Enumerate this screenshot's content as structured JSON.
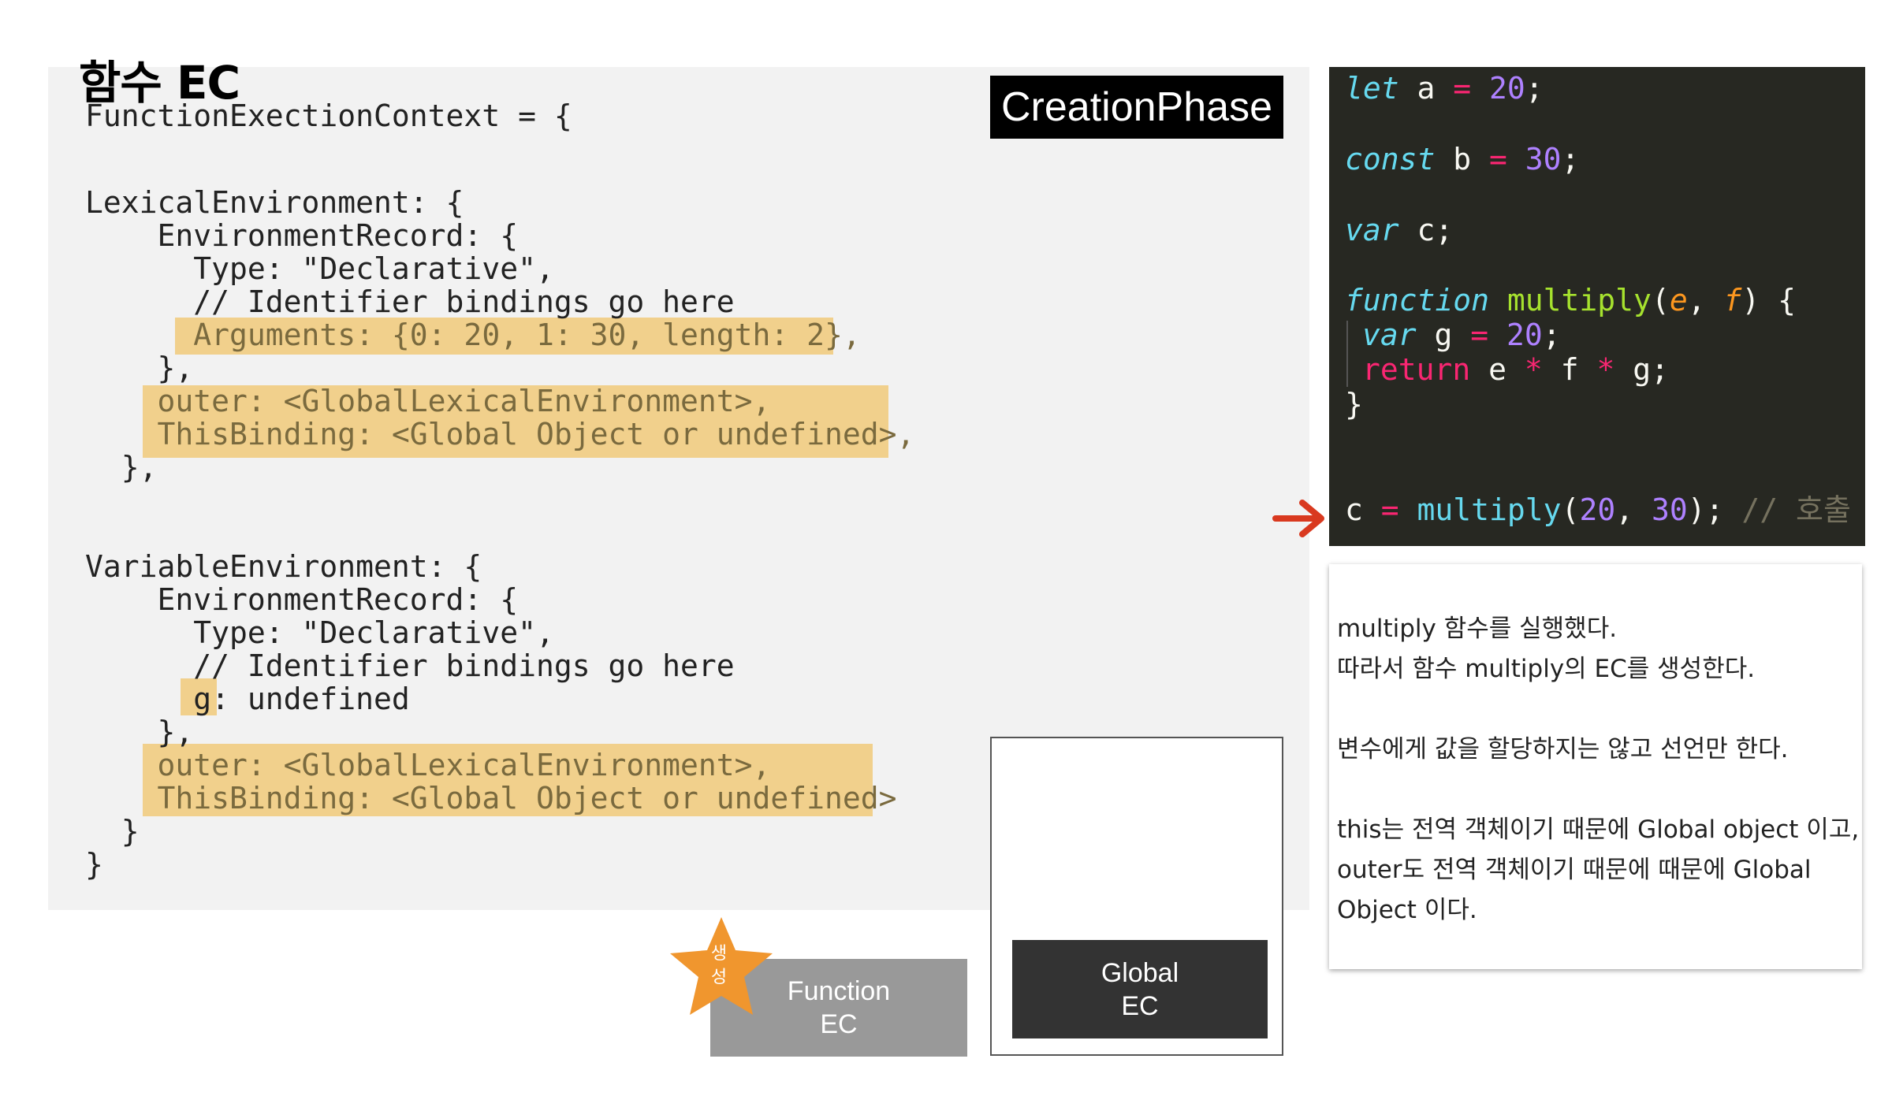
{
  "title": "함수 EC",
  "phase_label": "CreationPhase",
  "code_lines": [
    "FunctionExectionContext = {",
    "",
    "LexicalEnvironment: {",
    "    EnvironmentRecord: {",
    "      Type: \"Declarative\",",
    "      // Identifier bindings go here",
    "      Arguments: {0: 20, 1: 30, length: 2},",
    "    },",
    "    outer: <GlobalLexicalEnvironment>,",
    "    ThisBinding: <Global Object or undefined>,",
    "  },",
    "",
    "",
    "VariableEnvironment: {",
    "    EnvironmentRecord: {",
    "      Type: \"Declarative\",",
    "      // Identifier bindings go here",
    "      g: undefined",
    "    },",
    "    outer: <GlobalLexicalEnvironment>,",
    "    ThisBinding: <Global Object or undefined>",
    "  }",
    "}"
  ],
  "editor": {
    "line1": {
      "kw": "let",
      "name": " a ",
      "op": "=",
      "num": " 20",
      "end": ";"
    },
    "line2": {
      "kw": "const",
      "name": " b ",
      "op": "=",
      "num": " 30",
      "end": ";"
    },
    "line3": {
      "kw": "var",
      "name": " c;"
    },
    "line4": {
      "kw": "function",
      "fn": " multiply",
      "open": "(",
      "p1": "e",
      "sep": ", ",
      "p2": "f",
      "close": ") {"
    },
    "line5": {
      "kw": "var",
      "name": " g ",
      "op": "=",
      "num": " 20",
      "end": ";"
    },
    "line6": {
      "kw": "return",
      "expr1": " e ",
      "op1": "*",
      "expr2": " f ",
      "op2": "*",
      "expr3": " g;"
    },
    "line7": "}",
    "line8": {
      "name": "c ",
      "op": "=",
      "call": " multiply",
      "open": "(",
      "n1": "20",
      "sep": ", ",
      "n2": "30",
      "close": ");",
      "comment": " // 호출"
    }
  },
  "explanation": [
    "multiply 함수를 실행했다.",
    "따라서 함수 multiply의 EC를 생성한다.",
    "",
    "변수에게 값을 할당하지는 않고 선언만 한다.",
    "",
    "this는 전역 객체이기 때문에 Global object 이고,",
    "outer도 전역 객체이기 때문에 때문에 Global",
    "Object 이다."
  ],
  "stack": {
    "global_ec": "Global\nEC",
    "function_ec": "Function\nEC",
    "star_label": "생\n성"
  },
  "colors": {
    "highlight": "#f1d08c",
    "editor_bg": "#272822",
    "arrow": "#d9391f",
    "star": "#f0962e",
    "function_ec": "#999999",
    "global_ec": "#333333"
  }
}
